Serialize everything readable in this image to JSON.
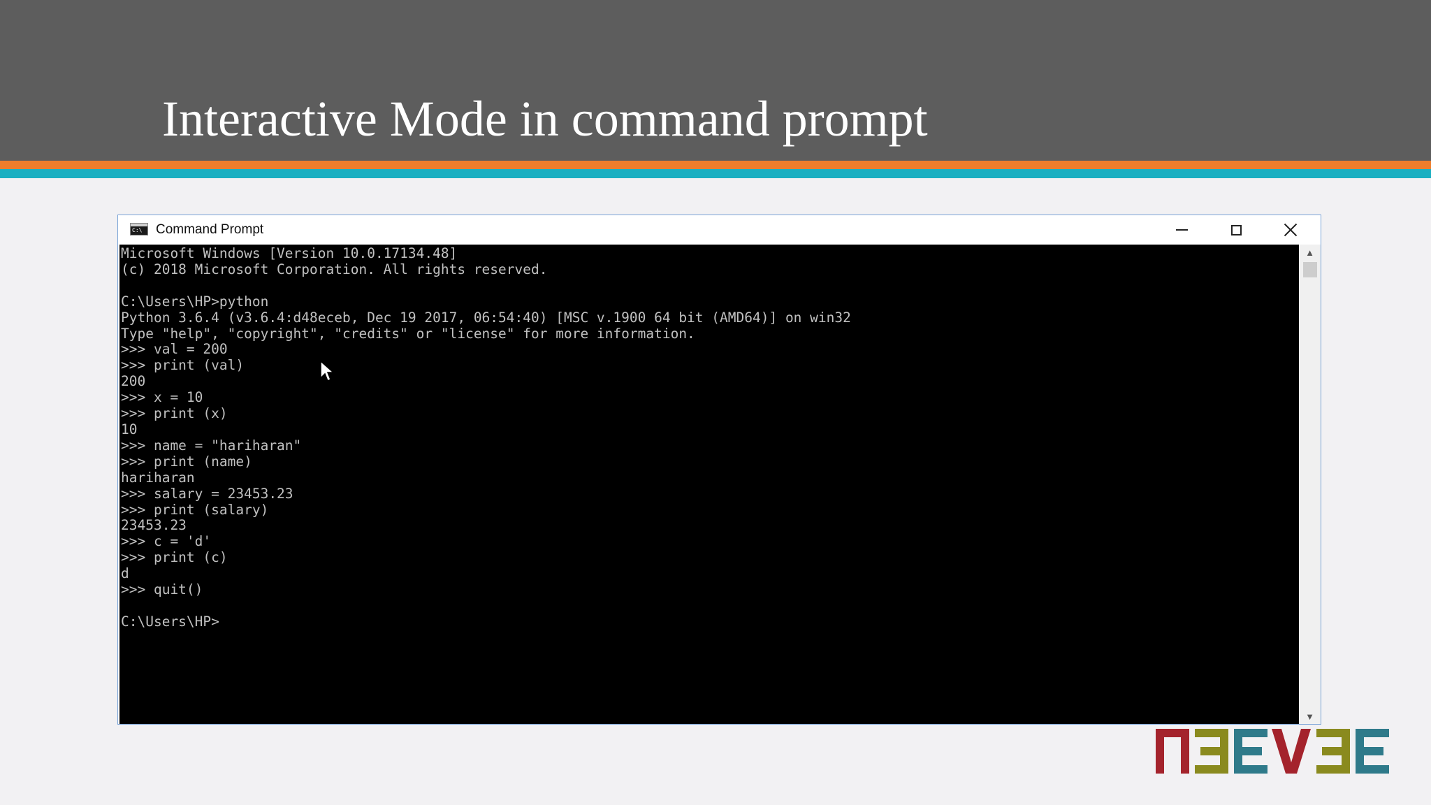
{
  "slide": {
    "title": "Interactive Mode in command prompt"
  },
  "window": {
    "title": "Command Prompt",
    "icon": "cmd-icon",
    "controls": {
      "minimize": "minimize-icon",
      "maximize": "maximize-icon",
      "close": "close-icon"
    }
  },
  "console": {
    "lines": [
      "Microsoft Windows [Version 10.0.17134.48]",
      "(c) 2018 Microsoft Corporation. All rights reserved.",
      "",
      "C:\\Users\\HP>python",
      "Python 3.6.4 (v3.6.4:d48eceb, Dec 19 2017, 06:54:40) [MSC v.1900 64 bit (AMD64)] on win32",
      "Type \"help\", \"copyright\", \"credits\" or \"license\" for more information.",
      ">>> val = 200",
      ">>> print (val)",
      "200",
      ">>> x = 10",
      ">>> print (x)",
      "10",
      ">>> name = \"hariharan\"",
      ">>> print (name)",
      "hariharan",
      ">>> salary = 23453.23",
      ">>> print (salary)",
      "23453.23",
      ">>> c = 'd'",
      ">>> print (c)",
      "d",
      ">>> quit()",
      "",
      "C:\\Users\\HP>"
    ]
  },
  "logo": {
    "name": "neeve-logo",
    "colors": [
      "#a4232c",
      "#8a8a1e",
      "#2f7a8a",
      "#a4232c",
      "#8a8a1e",
      "#2f7a8a"
    ]
  },
  "colors": {
    "header": "#5d5d5d",
    "stripe_orange": "#ee7d2c",
    "stripe_teal": "#1aafc1",
    "console_bg": "#000000",
    "console_fg": "#c0c0c0"
  }
}
